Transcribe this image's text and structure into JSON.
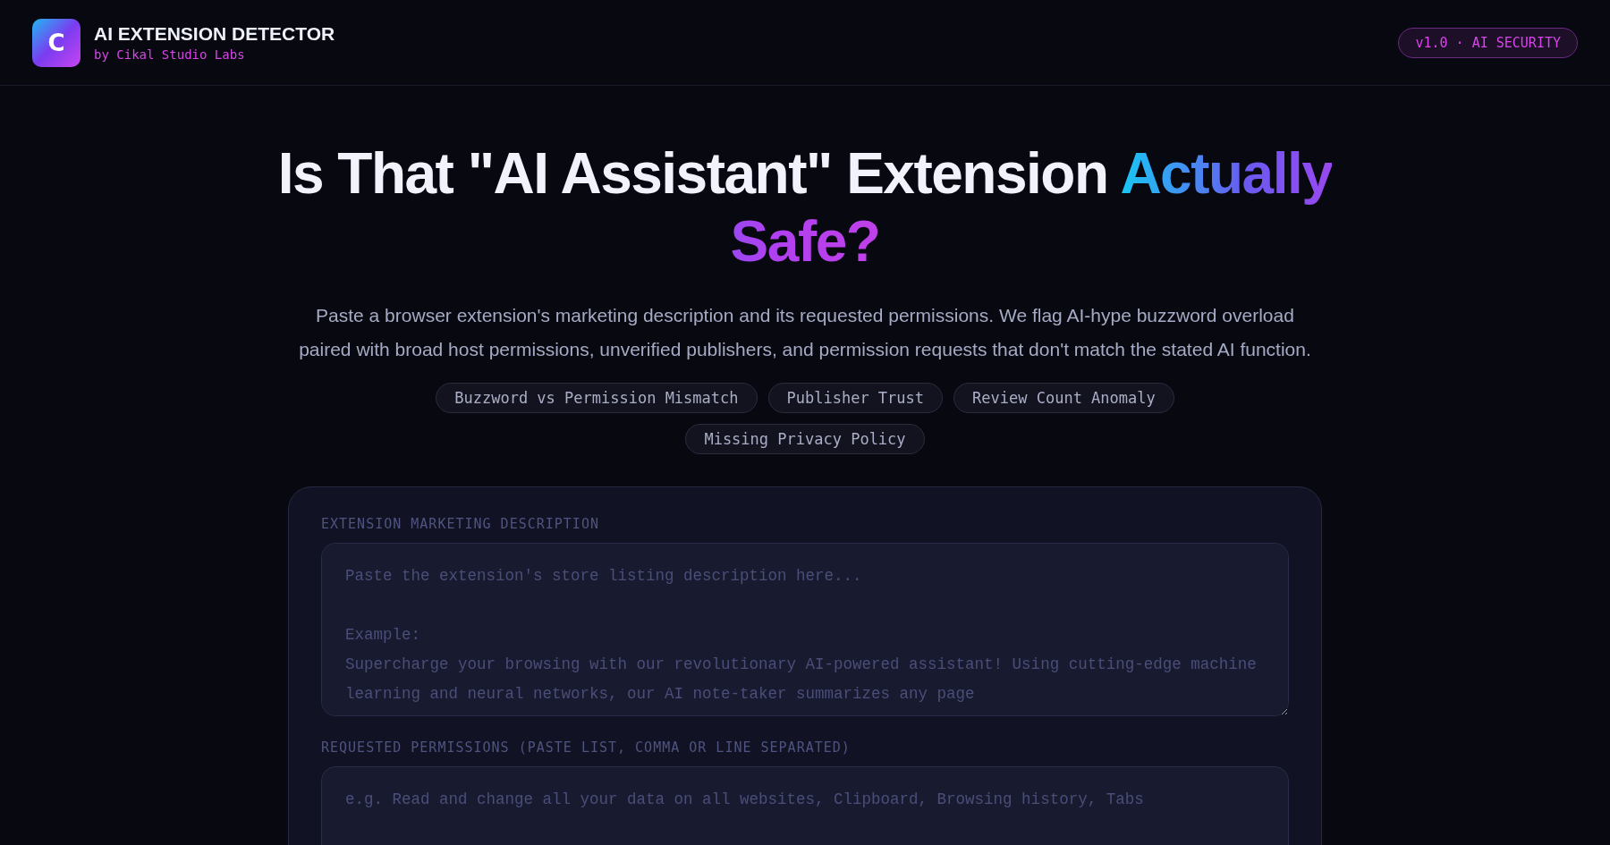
{
  "header": {
    "logo_letter": "C",
    "title": "AI EXTENSION DETECTOR",
    "subtitle": "by Cikal Studio Labs",
    "badge": "v1.0 · AI SECURITY"
  },
  "hero": {
    "title": "Is That \"AI Assistant\" Extension",
    "title_highlight": "Actually Safe?",
    "description": "Paste a browser extension's marketing description and its requested permissions. We flag AI-hype buzzword overload paired with broad host permissions, unverified publishers, and permission requests that don't match the stated AI function."
  },
  "tags": [
    "Buzzword vs Permission Mismatch",
    "Publisher Trust",
    "Review Count Anomaly",
    "Missing Privacy Policy"
  ],
  "form": {
    "fields": [
      {
        "label": "EXTENSION MARKETING DESCRIPTION",
        "placeholder": "Paste the extension's store listing description here...\n\nExample:\nSupercharge your browsing with our revolutionary AI-powered assistant! Using cutting-edge machine learning and neural networks, our AI note-taker summarizes any page"
      },
      {
        "label": "REQUESTED PERMISSIONS (PASTE LIST, COMMA OR LINE SEPARATED)",
        "placeholder": "e.g. Read and change all your data on all websites, Clipboard, Browsing history, Tabs"
      }
    ]
  }
}
